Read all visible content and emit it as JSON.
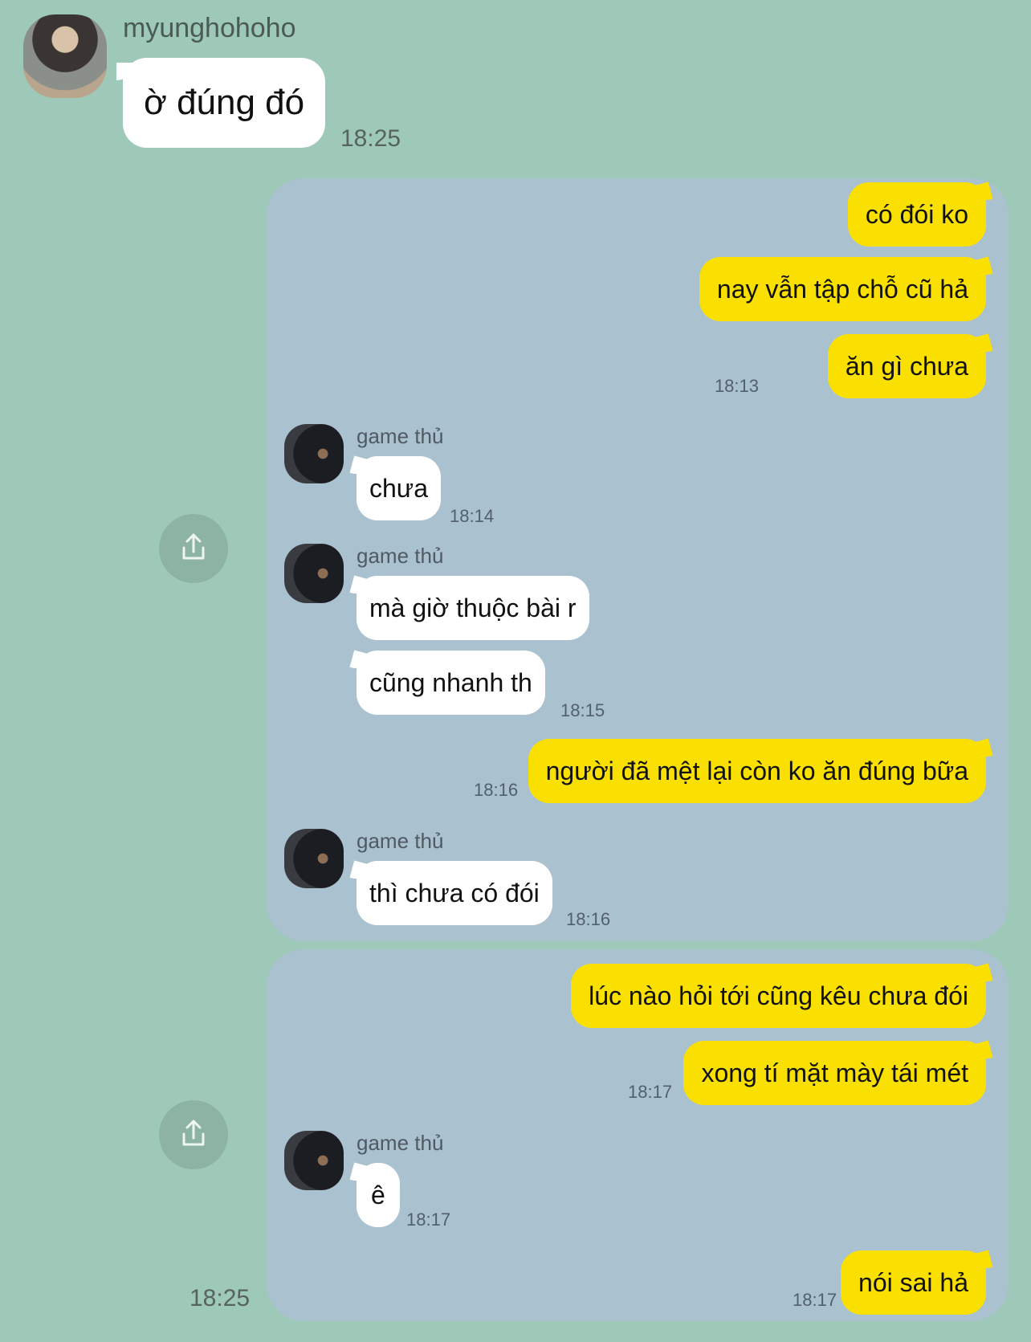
{
  "top": {
    "sender": "myunghohoho",
    "message": "ờ đúng đó",
    "time": "18:25"
  },
  "panel1": {
    "out1": "có đói ko",
    "out2": "nay vẫn tập chỗ cũ hả",
    "out3": "ăn gì chưa",
    "t1": "18:13",
    "sender1": "game thủ",
    "in1": "chưa",
    "t2": "18:14",
    "sender2": "game thủ",
    "in2": "mà giờ thuộc bài r",
    "in3": "cũng nhanh th",
    "t3": "18:15",
    "out4": "người đã mệt lại còn ko ăn đúng bữa",
    "t4": "18:16",
    "sender3": "game thủ",
    "in4": "thì chưa có đói",
    "t5": "18:16"
  },
  "panel2": {
    "out1": "lúc nào hỏi tới cũng kêu chưa đói",
    "out2": "xong tí mặt mày tái mét",
    "t1": "18:17",
    "sender1": "game thủ",
    "in1": "ê",
    "t2": "18:17",
    "out3": "nói sai hả",
    "t3": "18:17"
  },
  "bottom_time": "18:25",
  "icons": {
    "share": "share-icon"
  }
}
